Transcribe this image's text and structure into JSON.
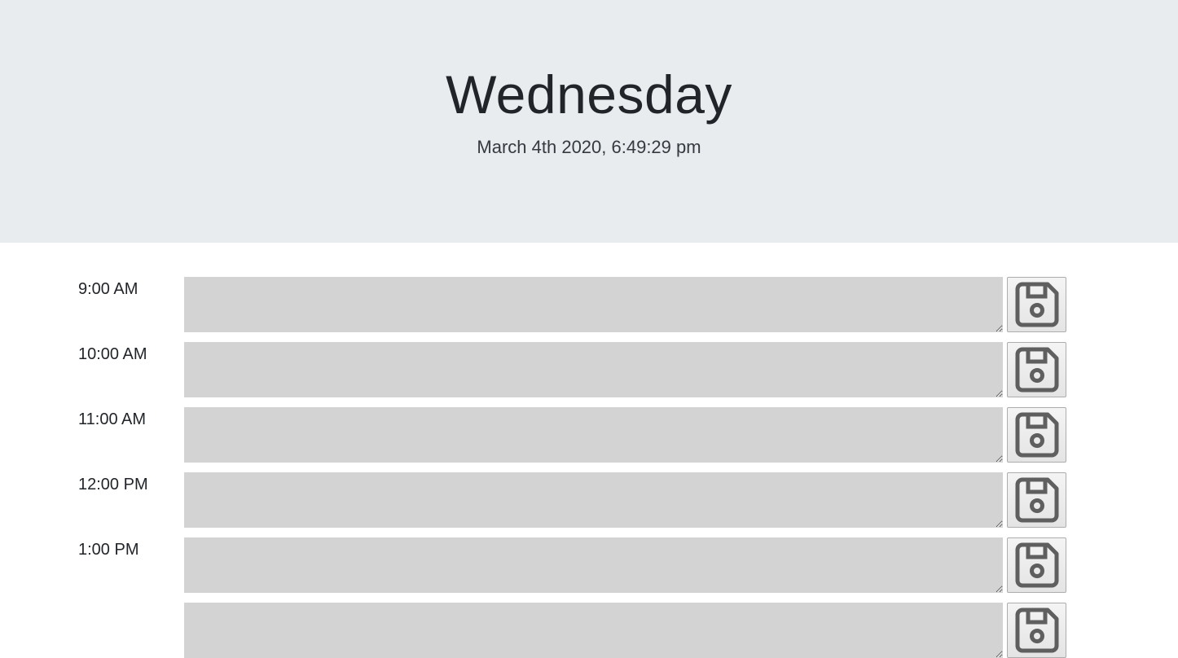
{
  "header": {
    "day": "Wednesday",
    "datetime": "March 4th 2020, 6:49:29 pm"
  },
  "schedule": {
    "rows": [
      {
        "hour": "9:00 AM",
        "text": ""
      },
      {
        "hour": "10:00 AM",
        "text": ""
      },
      {
        "hour": "11:00 AM",
        "text": ""
      },
      {
        "hour": "12:00 PM",
        "text": ""
      },
      {
        "hour": "1:00 PM",
        "text": ""
      },
      {
        "hour": "",
        "text": ""
      }
    ],
    "save_icon": "floppy-disk-icon"
  },
  "colors": {
    "header_bg": "#e9ecef",
    "past_block": "#d3d3d3",
    "icon": "#5f5f5f"
  }
}
